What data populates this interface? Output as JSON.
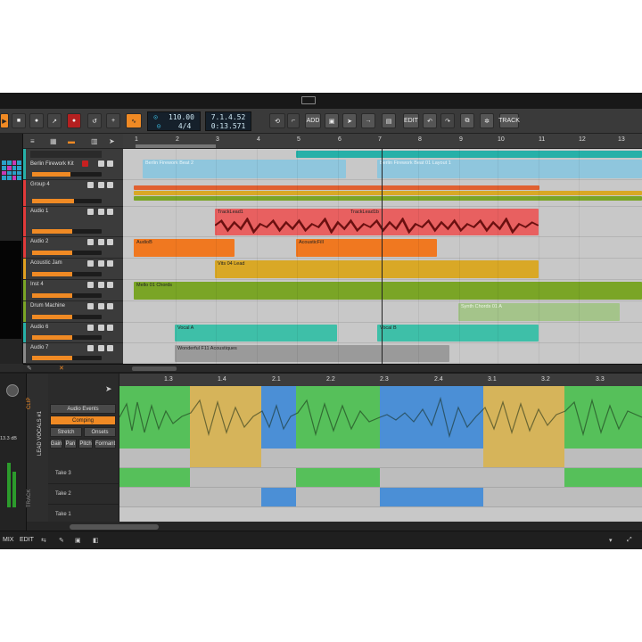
{
  "toolbar": {
    "tempo": "110.00",
    "signature": "4/4",
    "position_bars": "7.1.4.52",
    "position_time": "0:13.571",
    "add_label": "ADD",
    "edit_label": "EDIT",
    "track_label": "TRACK"
  },
  "ruler": {
    "bars": [
      "1",
      "2",
      "3",
      "4",
      "5",
      "6",
      "7",
      "8",
      "9",
      "10",
      "11",
      "12",
      "13"
    ]
  },
  "tracks": [
    {
      "name": "Berlin Firework Kit",
      "color": "#27b0a8"
    },
    {
      "name": "Group 4",
      "color": "#e03a3a"
    },
    {
      "name": "Audio 1",
      "color": "#e03a3a"
    },
    {
      "name": "Audio 2",
      "color": "#e03a3a"
    },
    {
      "name": "Acoustic Jam",
      "color": "#e0a020"
    },
    {
      "name": "Inst 4",
      "color": "#7aa526"
    },
    {
      "name": "Drum Machine",
      "color": "#7aa526"
    },
    {
      "name": "Audio 6",
      "color": "#27b0a8"
    },
    {
      "name": "Audio 7",
      "color": "#8a8a8a"
    }
  ],
  "clips": {
    "berlin_firework_kit": "Berlin Firework Beat 2",
    "berlin_firework_kit_2": "Berlin Firework Beat 01 Layout 1",
    "tracklead": "TrackLead1",
    "tracklead_2": "TrackLead1b",
    "audio_b": "AudioB",
    "acoustic_fill": "AcousticFill",
    "vits_lead": "Vits 04 Lead",
    "inst_chords": "Mello 01 Chords",
    "drum_chords": "Synth Chords 01 A",
    "vocal_a": "Vocal A",
    "vocal_b": "Vocal B",
    "acoustic": "Wonderful F11 Acoustiques"
  },
  "editor": {
    "ruler": [
      "1.3",
      "1.4",
      "2.1",
      "2.2",
      "2.3",
      "2.4",
      "3.1",
      "3.2",
      "3.3"
    ],
    "audio_events_label": "Audio Events",
    "comping_label": "Comping",
    "stretch_label": "Stretch",
    "onsets_label": "Onsets",
    "gain_label": "Gain",
    "pan_label": "Pan",
    "pitch_label": "Pitch",
    "formant_label": "Formant",
    "vertical_label": "LEAD VOCALS #1",
    "clip_vertical": "CLIP",
    "track_vertical": "TRACK",
    "level_db": "13.3 dB",
    "takes": [
      "Take 3",
      "Take 2",
      "Take 1"
    ]
  },
  "footer": {
    "mix_label": "MIX",
    "edit_label": "EDIT"
  },
  "colors": {
    "accent": "#f08a24",
    "teal": "#27b0a8",
    "red": "#e03a3a",
    "orange": "#f07820",
    "yellow": "#d9a826",
    "green": "#7aa526",
    "comp_green": "#56c05a",
    "comp_yellow": "#d6b45a",
    "comp_blue": "#4b8fd6"
  }
}
